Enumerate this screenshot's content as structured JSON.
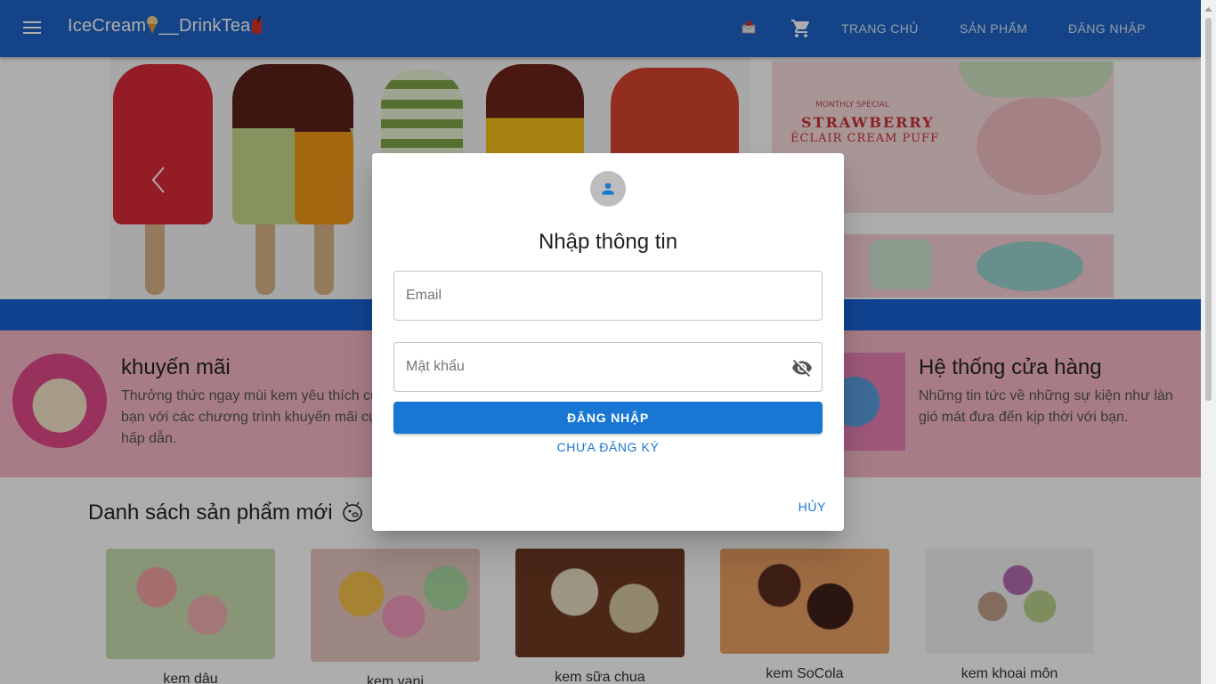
{
  "header": {
    "brand_part1": "IceCream",
    "brand_part2": "__DrinkTea",
    "nav": [
      {
        "label": "TRANG CHỦ"
      },
      {
        "label": "SẢN PHẨM"
      },
      {
        "label": "ĐĂNG NHẬP"
      }
    ],
    "icons": [
      "menu-icon",
      "mailbox-icon",
      "cart-icon"
    ],
    "bar_color": "#1e64c8"
  },
  "hero": {
    "promo_small": "MONTHLY SPECIAL",
    "promo_big": "STRAWBERRY",
    "promo_sub": "ÉCLAIR CREAM PUFF"
  },
  "info": [
    {
      "title": "khuyến mãi",
      "text_lines": [
        "Thưởng thức ngay mùi kem yêu thích củ",
        "bạn với các chương trình khuyến mãi cự",
        "hấp dẫn."
      ]
    },
    {
      "title": "Hệ thống cửa hàng",
      "text_lines": [
        "Những tin tức về những sự kiện như làn",
        "gió mát đưa đến kịp thời với bạn."
      ]
    }
  ],
  "products": {
    "section_title": "Danh sách sản phẩm mới",
    "items": [
      {
        "name": "kem dâu"
      },
      {
        "name": "kem vani"
      },
      {
        "name": "kem sữa chua"
      },
      {
        "name": "kem SoCola"
      },
      {
        "name": "kem khoai môn"
      }
    ]
  },
  "dialog": {
    "title": "Nhập thông tin",
    "email_placeholder": "Email",
    "password_placeholder": "Mật khẩu",
    "login_label": "ĐĂNG NHẬP",
    "register_label": "CHƯA ĐĂNG KÝ",
    "cancel_label": "HỦY",
    "accent_color": "#1976d2",
    "icons": [
      "account-icon",
      "visibility-off-icon"
    ]
  }
}
